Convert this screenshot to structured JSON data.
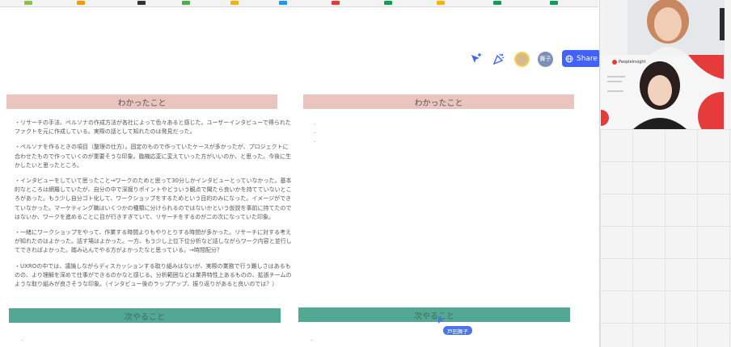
{
  "toolbar": {
    "share_label": "Share",
    "avatar_initials": "舞子"
  },
  "left_column": {
    "header": "わかったこと",
    "paragraphs": [
      "・リサーチの手法、ペルソナの作成方法が各社によって色々あると感じた。ユーザーインタビューで得られたファクトを元に作成している。実際の話として知れたのは発見だった。",
      "・ペルソナを作るときの項目（整理の仕方）。固定のもので作っていたケースが多かったが、プロジェクトに合わせたもので作っていくのが重要そうな印象。臨機応変に変えていった方がいいのか、と思った。今後に生かしたいと思ったところ。",
      "・インタビューをしていて思ったこと→ワークのためと思って30分しかインタビューとっていなかった。基本的なところは網羅していたが、自分の中で深掘りポイントやどういう観点で聞たら良いかを持てていないところがあった。もう少し自分ゴト化して、ワークショップをするためという目的のみになった。イメージができていなかった。マーケティング職はいくつかの種類に分けられるのではないかという仮説を事前に持てたのではないか、ワークを進めることに目が行きすぎていて、リサーチをするのが二の次になっていた印象。",
      "・一緒にワークショップをやって、作業する時間よりもやりとりする時間が多かった。リサーチに対する考えが知れたのはよかった。話す場はよかった。一方、もう少し上位下位分析など話しながらワーク内容と並行してできればよかった。踏み込んでやる方がよかったなと思っている。→時間配分？",
      "・UXROの中では、議論しながらディスカッションする取り組みはないが、実際の業務で行う難しさはあるものの、より理解を深めて仕事ができるのかなと感じる。分析範囲などは業界特性上あるものの、拡張チームのような取り組みが良さそうな印象。（インタビュー後のラップアップ、振り返りがあると良いのでは？）"
    ],
    "next_header": "次やること"
  },
  "right_column": {
    "header": "わかったこと",
    "next_header": "次やること"
  },
  "cursor": {
    "user_label": "戸田舞子"
  },
  "video_panel": {
    "brand": "PeopleInsight"
  },
  "colors": {
    "pink_header": "#eac4bf",
    "green_header": "#52a892",
    "share_blue": "#4262ff",
    "cursor_blue": "#4a74e8"
  },
  "icons": [
    "select-cursor-icon",
    "celebrate-icon",
    "globe-icon"
  ]
}
